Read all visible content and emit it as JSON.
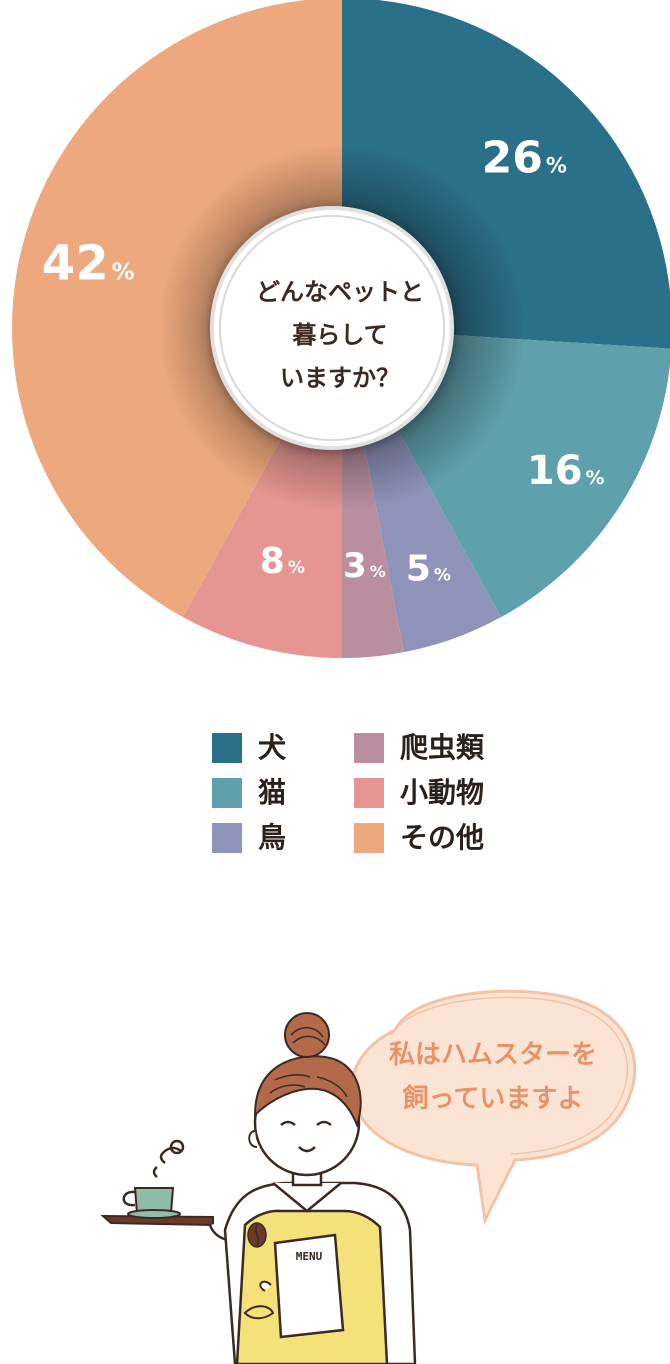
{
  "chart_data": {
    "type": "pie",
    "title": "どんなペットと暮らしていますか？",
    "title_lines": [
      "どんなペットと",
      "暮らして",
      "いますか？"
    ],
    "unit": "%",
    "slices": [
      {
        "name": "犬",
        "value": 26,
        "color": "#2b7089"
      },
      {
        "name": "猫",
        "value": 16,
        "color": "#5ea0ac"
      },
      {
        "name": "鳥",
        "value": 5,
        "color": "#8e93ba"
      },
      {
        "name": "爬虫類",
        "value": 3,
        "color": "#b98fa0"
      },
      {
        "name": "小動物",
        "value": 8,
        "color": "#e69592"
      },
      {
        "name": "その他",
        "value": 42,
        "color": "#eda87d"
      }
    ],
    "legend_columns": [
      [
        "犬",
        "猫",
        "鳥"
      ],
      [
        "爬虫類",
        "小動物",
        "その他"
      ]
    ]
  },
  "illustration": {
    "speech_bubble_lines": [
      "私はハムスターを",
      "飼っていますよ"
    ],
    "menu_label": "MENU",
    "colors": {
      "apron": "#f5e17a",
      "cup": "#8fbca6",
      "hair": "#b36a4a"
    }
  }
}
